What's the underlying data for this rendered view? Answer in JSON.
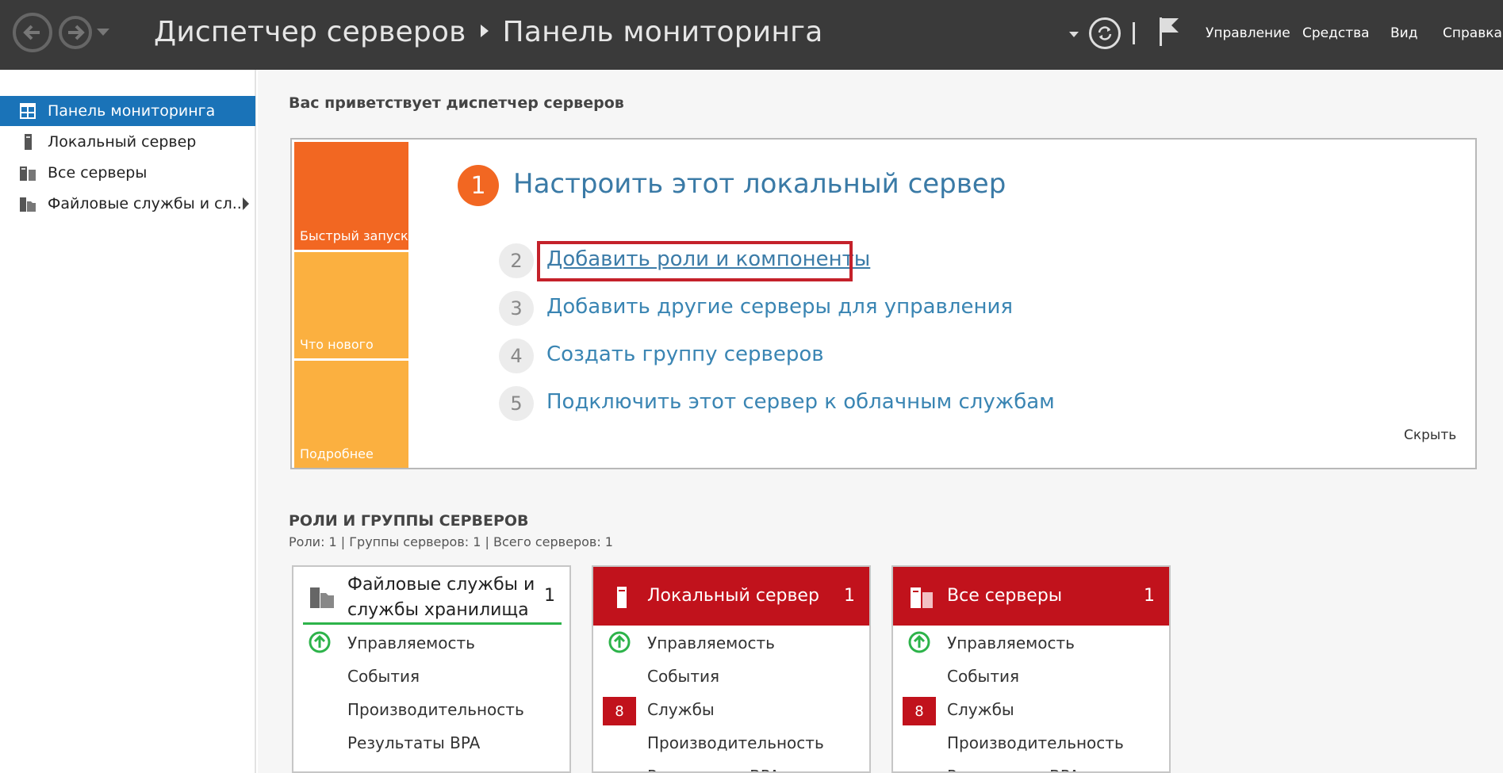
{
  "header": {
    "title": "Диспетчер серверов",
    "subtitle": "Панель мониторинга",
    "menu": [
      "Управление",
      "Средства",
      "Вид",
      "Справка"
    ]
  },
  "sidebar": {
    "items": [
      {
        "label": "Панель мониторинга"
      },
      {
        "label": "Локальный сервер"
      },
      {
        "label": "Все серверы"
      },
      {
        "label": "Файловые службы и сл..."
      }
    ]
  },
  "welcome": "Вас приветствует диспетчер серверов",
  "tiles": [
    "Быстрый запуск",
    "Что нового",
    "Подробнее"
  ],
  "steps": [
    {
      "num": "1",
      "label": "Настроить этот локальный сервер"
    },
    {
      "num": "2",
      "label": "Добавить роли и компоненты"
    },
    {
      "num": "3",
      "label": "Добавить другие серверы для управления"
    },
    {
      "num": "4",
      "label": "Создать группу серверов"
    },
    {
      "num": "5",
      "label": "Подключить этот сервер к облачным службам"
    }
  ],
  "hide_label": "Скрыть",
  "roles": {
    "title": "РОЛИ И ГРУППЫ СЕРВЕРОВ",
    "summary": "Роли: 1 | Группы серверов: 1 | Всего серверов: 1"
  },
  "cards": [
    {
      "title_line1": "Файловые службы и",
      "title_line2": "службы хранилища",
      "count": "1",
      "rows": [
        "Управляемость",
        "События",
        "Производительность",
        "Результаты BPA"
      ]
    },
    {
      "title": "Локальный сервер",
      "count": "1",
      "services_badge": "8",
      "rows": [
        "Управляемость",
        "События",
        "Службы",
        "Производительность",
        "Результаты BPA"
      ]
    },
    {
      "title": "Все серверы",
      "count": "1",
      "services_badge": "8",
      "rows": [
        "Управляемость",
        "События",
        "Службы",
        "Производительность",
        "Результаты BPA"
      ]
    }
  ],
  "colors": {
    "topbar": "#3a3a3a",
    "accent_blue": "#1a73b8",
    "tile_orange": "#f26722",
    "tile_yellow": "#fbb040",
    "card_red": "#c1121c",
    "ok_green": "#2db34a"
  }
}
